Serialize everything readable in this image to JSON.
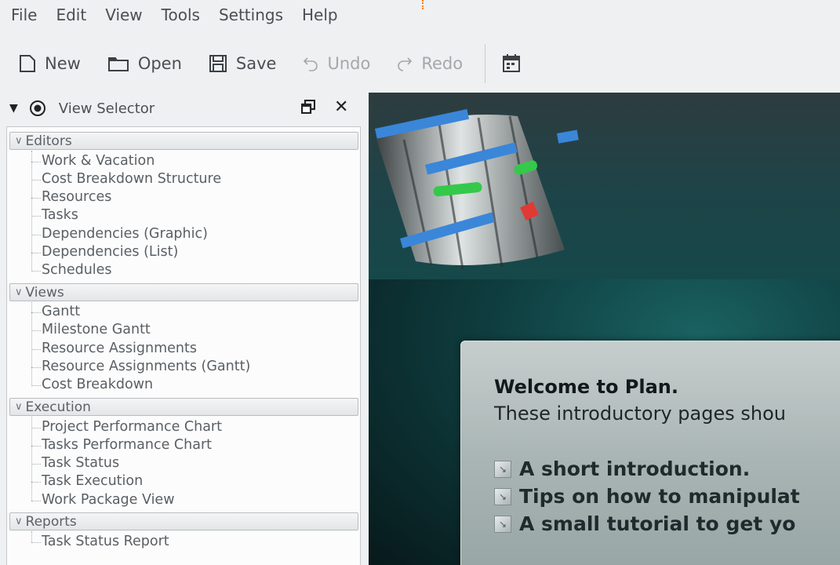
{
  "menu": [
    "File",
    "Edit",
    "View",
    "Tools",
    "Settings",
    "Help"
  ],
  "toolbar": {
    "new": "New",
    "open": "Open",
    "save": "Save",
    "undo": "Undo",
    "redo": "Redo",
    "icons": [
      "new-document-icon",
      "open-folder-icon",
      "save-icon",
      "undo-icon",
      "redo-icon",
      "calendar-icon"
    ]
  },
  "dock": {
    "title": "View Selector",
    "categories": [
      {
        "label": "Editors",
        "items": [
          "Work & Vacation",
          "Cost Breakdown Structure",
          "Resources",
          "Tasks",
          "Dependencies (Graphic)",
          "Dependencies (List)",
          "Schedules"
        ]
      },
      {
        "label": "Views",
        "items": [
          "Gantt",
          "Milestone Gantt",
          "Resource Assignments",
          "Resource Assignments (Gantt)",
          "Cost Breakdown"
        ]
      },
      {
        "label": "Execution",
        "items": [
          "Project Performance Chart",
          "Tasks Performance Chart",
          "Task Status",
          "Task Execution",
          "Work Package View"
        ]
      },
      {
        "label": "Reports",
        "items": [
          "Task Status Report"
        ]
      }
    ]
  },
  "welcome": {
    "heading": "Welcome to Plan.",
    "subtitle": "These introductory pages shou",
    "links": [
      "A short introduction.",
      "Tips on how to manipulat",
      "A small tutorial to get yo"
    ]
  },
  "colors": {
    "accent_orange": "#f58220",
    "panel_bg": "#eff0f1",
    "welcome_dark": "#0b2528"
  }
}
